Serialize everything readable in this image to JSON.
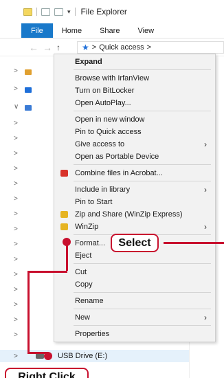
{
  "window": {
    "title": "File Explorer"
  },
  "ribbon": {
    "tabs": [
      "File",
      "Home",
      "Share",
      "View"
    ]
  },
  "address_bar": {
    "path_label": "Quick access",
    "separator": ">"
  },
  "nav_tree": {
    "selected_item": "USB Drive (E:)"
  },
  "context_menu": {
    "items": [
      {
        "label": "Expand",
        "bold": true
      },
      {
        "label": "Browse with IrfanView"
      },
      {
        "label": "Turn on BitLocker"
      },
      {
        "label": "Open AutoPlay..."
      },
      {
        "label": "Open in new window"
      },
      {
        "label": "Pin to Quick access"
      },
      {
        "label": "Give access to",
        "submenu": true
      },
      {
        "label": "Open as Portable Device"
      },
      {
        "label": "Combine files in Acrobat...",
        "icon": "acrobat-icon"
      },
      {
        "label": "Include in library",
        "submenu": true
      },
      {
        "label": "Pin to Start"
      },
      {
        "label": "Zip and Share (WinZip Express)",
        "icon": "winzip-icon"
      },
      {
        "label": "WinZip",
        "icon": "winzip-icon",
        "submenu": true
      },
      {
        "label": "Format..."
      },
      {
        "label": "Eject"
      },
      {
        "label": "Cut"
      },
      {
        "label": "Copy"
      },
      {
        "label": "Rename"
      },
      {
        "label": "New",
        "submenu": true
      },
      {
        "label": "Properties"
      }
    ]
  },
  "callouts": {
    "select": "Select",
    "right_click": "Right Click"
  },
  "colors": {
    "accent": "#1979ca",
    "callout": "#c8102e",
    "menu_bg": "#f2f2f2",
    "selected_row": "#e5f1fb"
  }
}
